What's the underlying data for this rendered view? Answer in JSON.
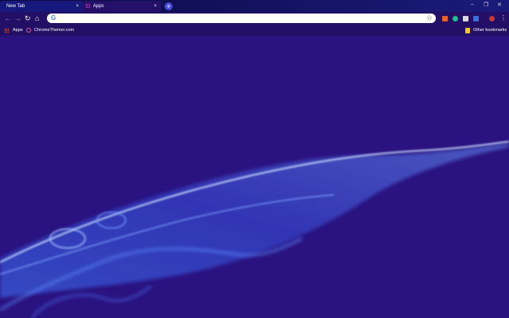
{
  "tabs": [
    {
      "label": "New Tab",
      "close": "×",
      "active": true
    },
    {
      "label": "Apps",
      "close": "×",
      "active": false
    }
  ],
  "new_tab_symbol": "+",
  "window_controls": {
    "minimize": "–",
    "restore": "❐",
    "close": "✕"
  },
  "toolbar": {
    "back": "←",
    "forward": "→",
    "reload": "↻",
    "home": "⌂",
    "search_engine_icon": "G",
    "bookmark_star": "☆",
    "menu": "⋮"
  },
  "extensions": [
    {
      "name": "extension-orange",
      "color": "#e8622c"
    },
    {
      "name": "extension-green",
      "color": "#1fbf8f"
    },
    {
      "name": "extension-pocket",
      "color": "#d9d9e6"
    },
    {
      "name": "extension-blue",
      "color": "#3a6fe0"
    },
    {
      "name": "profile-avatar",
      "color": "#c43b3b"
    }
  ],
  "bookmarks": {
    "apps_label": "Apps",
    "site_label": "ChromeThemer.com",
    "other_label": "Other bookmarks"
  },
  "colors": {
    "background": "#2a1280",
    "tab_active": "#16187c",
    "tab_inactive": "#241069",
    "smoke_glow": "#4a7cff"
  }
}
